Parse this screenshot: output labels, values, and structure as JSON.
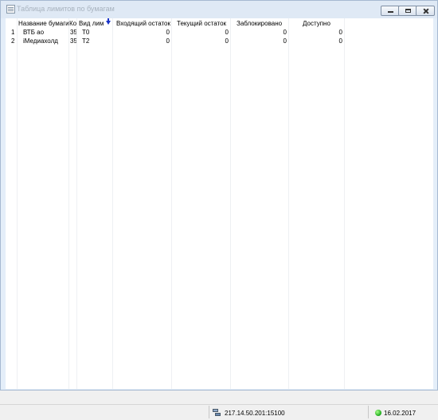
{
  "window": {
    "title": "Таблица лимитов по бумагам"
  },
  "table": {
    "columns": [
      "Название бумаги",
      "Ко",
      "Вид лим",
      "Входящий остаток",
      "Текущий остаток",
      "Заблокировано",
      "Доступно"
    ],
    "rows": [
      {
        "num": "1",
        "name": "ВТБ ао",
        "code": "35.",
        "type": "T0",
        "incoming": "0",
        "current": "0",
        "blocked": "0",
        "available": "0"
      },
      {
        "num": "2",
        "name": "iМедиахолд",
        "code": "35.",
        "type": "T2",
        "incoming": "0",
        "current": "0",
        "blocked": "0",
        "available": "0"
      }
    ],
    "sort_indicator": "sort-desc-icon"
  },
  "statusbar": {
    "server": "217.14.50.201:15100",
    "date": "16.02.2017",
    "connection_color": "#1ca81c"
  }
}
